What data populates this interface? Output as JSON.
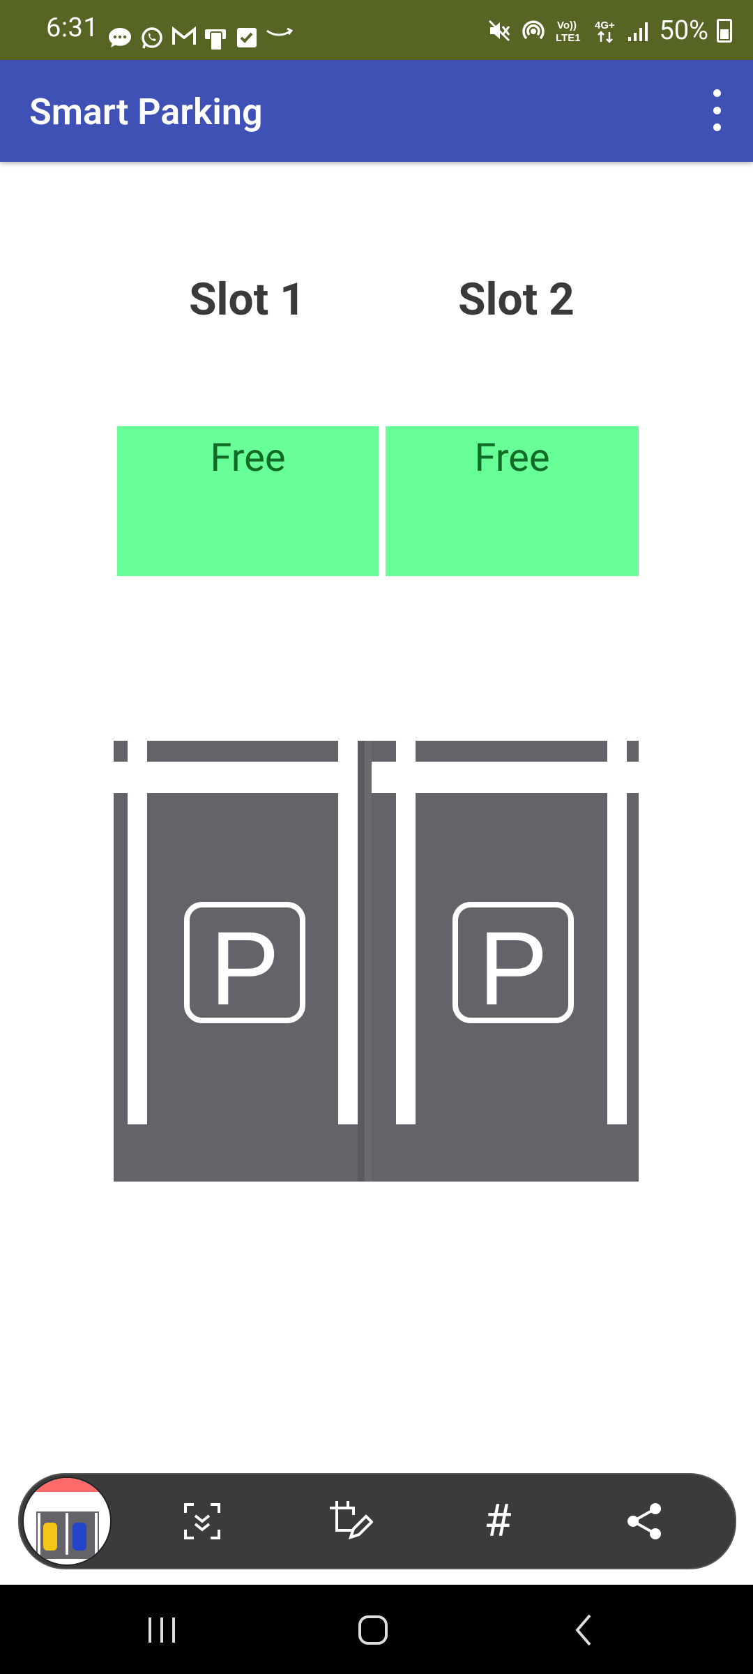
{
  "status_bar": {
    "time": "6:31",
    "battery": "50%",
    "left_icons": [
      "chat-bubble-icon",
      "whatsapp-icon",
      "gmail-icon",
      "device-icon",
      "checkbox-icon",
      "amazon-icon"
    ],
    "right_icons": [
      "mute-icon",
      "hotspot-icon",
      "volte-icon",
      "network-4g-icon",
      "signal-icon",
      "battery-icon"
    ],
    "volte_label": "Vo)) LTE1",
    "network_label": "4G+"
  },
  "app_bar": {
    "title": "Smart Parking",
    "overflow_icon": "more-vert-icon",
    "color": "#3f51b5"
  },
  "slots": [
    {
      "label": "Slot 1",
      "status": "Free"
    },
    {
      "label": "Slot 2",
      "status": "Free"
    }
  ],
  "colors": {
    "free_background": "#69ff98",
    "free_text": "#116b27",
    "asphalt": "#636369"
  },
  "parking_image": {
    "signs": [
      "P",
      "P"
    ],
    "icon": "parking-sign-icon"
  },
  "capture_toolbar": {
    "items": [
      "scroll-capture-icon",
      "crop-edit-icon",
      "hashtag-icon",
      "share-icon"
    ],
    "hashtag_glyph": "#"
  },
  "nav_bar": {
    "items": [
      "recents-icon",
      "home-icon",
      "back-icon"
    ]
  }
}
